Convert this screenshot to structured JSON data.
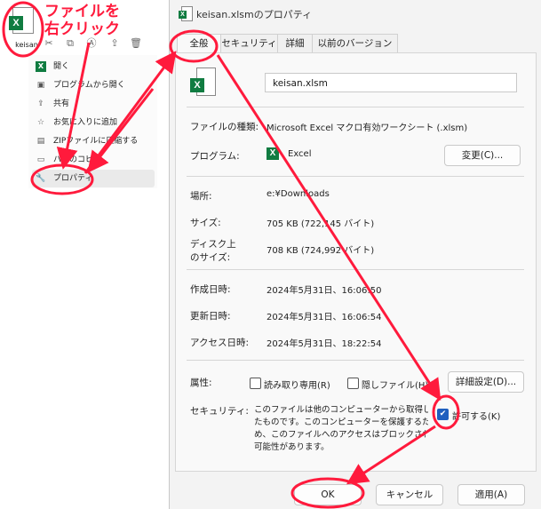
{
  "annotation": {
    "text_line1": "ファイルを",
    "text_line2": "右クリック",
    "color": "#ff1a3c"
  },
  "explorer": {
    "file_name": "keisan",
    "file_icon": "excel-file-icon",
    "toolbar_icons": [
      "cut-icon",
      "copy-icon",
      "rename-icon",
      "share-icon",
      "delete-icon"
    ],
    "menu": [
      {
        "icon": "excel-icon",
        "label": "開く"
      },
      {
        "icon": "open-with-icon",
        "label": "プログラムから開く"
      },
      {
        "icon": "share-icon",
        "label": "共有"
      },
      {
        "icon": "star-icon",
        "label": "お気に入りに追加"
      },
      {
        "icon": "zip-icon",
        "label": "ZIPファイルに圧縮する"
      },
      {
        "icon": "path-copy-icon",
        "label": "パスのコピー"
      },
      {
        "icon": "wrench-icon",
        "label": "プロパティ"
      }
    ]
  },
  "dialog": {
    "title": "keisan.xlsmのプロパティ",
    "tabs": [
      "全般",
      "セキュリティ",
      "詳細",
      "以前のバージョン"
    ],
    "file_name": "keisan.xlsm",
    "type_label": "ファイルの種類:",
    "type_value": "Microsoft Excel マクロ有効ワークシート (.xlsm)",
    "program_label": "プログラム:",
    "program_value": "Excel",
    "change_button": "変更(C)...",
    "location_label": "場所:",
    "location_value": "e:¥Downloads",
    "size_label": "サイズ:",
    "size_value": "705 KB (722,145 バイト)",
    "disk_label_1": "ディスク上",
    "disk_label_2": "のサイズ:",
    "disk_value": "708 KB (724,992 バイト)",
    "created_label": "作成日時:",
    "created_value": "2024年5月31日、16:06:50",
    "modified_label": "更新日時:",
    "modified_value": "2024年5月31日、16:06:54",
    "accessed_label": "アクセス日時:",
    "accessed_value": "2024年5月31日、18:22:54",
    "attr_label": "属性:",
    "readonly_label": "読み取り専用(R)",
    "hidden_label": "隠しファイル(H)",
    "advanced_button": "詳細設定(D)...",
    "security_label": "セキュリティ:",
    "security_text": [
      "このファイルは他のコンピューターから取得したものです。このコンピューターを保護するた",
      "め、このファイルへのアクセスはブロックされる",
      "可能性があります。"
    ],
    "security_line1": "このファイルは他のコンピューターから取得し",
    "security_line2": "たものです。このコンピューターを保護するた",
    "security_line3": "め、このファイルへのアクセスはブロックされる",
    "security_line4": "可能性があります。",
    "allow_label": "許可する(K)",
    "allow_checked": true,
    "ok_button": "OK",
    "cancel_button": "キャンセル",
    "apply_button": "適用(A)"
  }
}
